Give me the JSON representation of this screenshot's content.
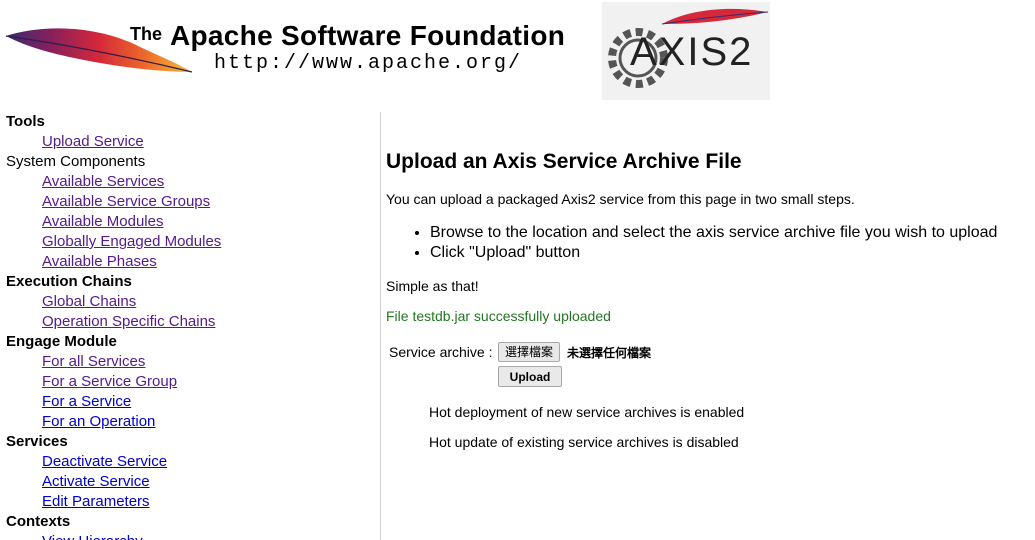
{
  "header": {
    "asf_the": "The",
    "asf_name": "Apache Software Foundation",
    "asf_url": "http://www.apache.org/",
    "axis_logo_text": "AXIS2"
  },
  "sidebar": {
    "sections": [
      {
        "type": "head",
        "label": "Tools"
      },
      {
        "type": "link",
        "label": "Upload Service",
        "visited": true
      },
      {
        "type": "plain",
        "label": "System Components"
      },
      {
        "type": "link",
        "label": "Available Services",
        "visited": true
      },
      {
        "type": "link",
        "label": "Available Service Groups",
        "visited": true
      },
      {
        "type": "link",
        "label": "Available Modules",
        "visited": true
      },
      {
        "type": "link",
        "label": "Globally Engaged Modules",
        "visited": true
      },
      {
        "type": "link",
        "label": "Available Phases",
        "visited": true
      },
      {
        "type": "head",
        "label": "Execution Chains"
      },
      {
        "type": "link",
        "label": "Global Chains",
        "visited": true
      },
      {
        "type": "link",
        "label": "Operation Specific Chains",
        "visited": true
      },
      {
        "type": "head",
        "label": "Engage Module"
      },
      {
        "type": "link",
        "label": "For all Services",
        "visited": true
      },
      {
        "type": "link",
        "label": "For a Service Group",
        "visited": true
      },
      {
        "type": "link",
        "label": "For a Service",
        "visited": false
      },
      {
        "type": "link",
        "label": "For an Operation",
        "visited": false
      },
      {
        "type": "head",
        "label": "Services"
      },
      {
        "type": "link",
        "label": "Deactivate Service",
        "visited": false
      },
      {
        "type": "link",
        "label": "Activate Service",
        "visited": false
      },
      {
        "type": "link",
        "label": "Edit Parameters",
        "visited": false
      },
      {
        "type": "head",
        "label": "Contexts"
      },
      {
        "type": "link",
        "label": "View Hierarchy",
        "visited": false
      }
    ]
  },
  "main": {
    "title": "Upload an Axis Service Archive File",
    "intro": "You can upload a packaged Axis2 service from this page in two small steps.",
    "steps": [
      "Browse to the location and select the axis service archive file you wish to upload",
      "Click \"Upload\" button"
    ],
    "simple": "Simple as that!",
    "success": "File testdb.jar successfully uploaded",
    "form": {
      "label": "Service archive :",
      "file_button": "選擇檔案",
      "no_file": "未選擇任何檔案",
      "upload_button": "Upload"
    },
    "hot_deploy": "Hot deployment of new service archives is enabled",
    "hot_update": "Hot update of existing service archives is disabled"
  },
  "colors": {
    "visited_link": "#551a8b",
    "link": "#0000cc",
    "success": "#227722"
  }
}
